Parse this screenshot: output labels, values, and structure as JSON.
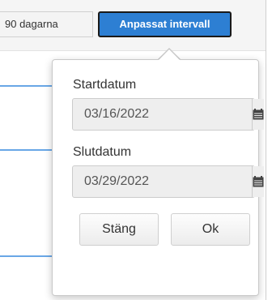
{
  "toolbar": {
    "range_90_label": "90 dagarna",
    "range_custom_label": "Anpassat intervall"
  },
  "popover": {
    "start_label": "Startdatum",
    "start_value": "03/16/2022",
    "end_label": "Slutdatum",
    "end_value": "03/29/2022",
    "calendar_icon": "calendar-icon",
    "close_label": "Stäng",
    "ok_label": "Ok"
  },
  "colors": {
    "accent": "#2d7fd3",
    "chart_line": "#69a7e6"
  }
}
